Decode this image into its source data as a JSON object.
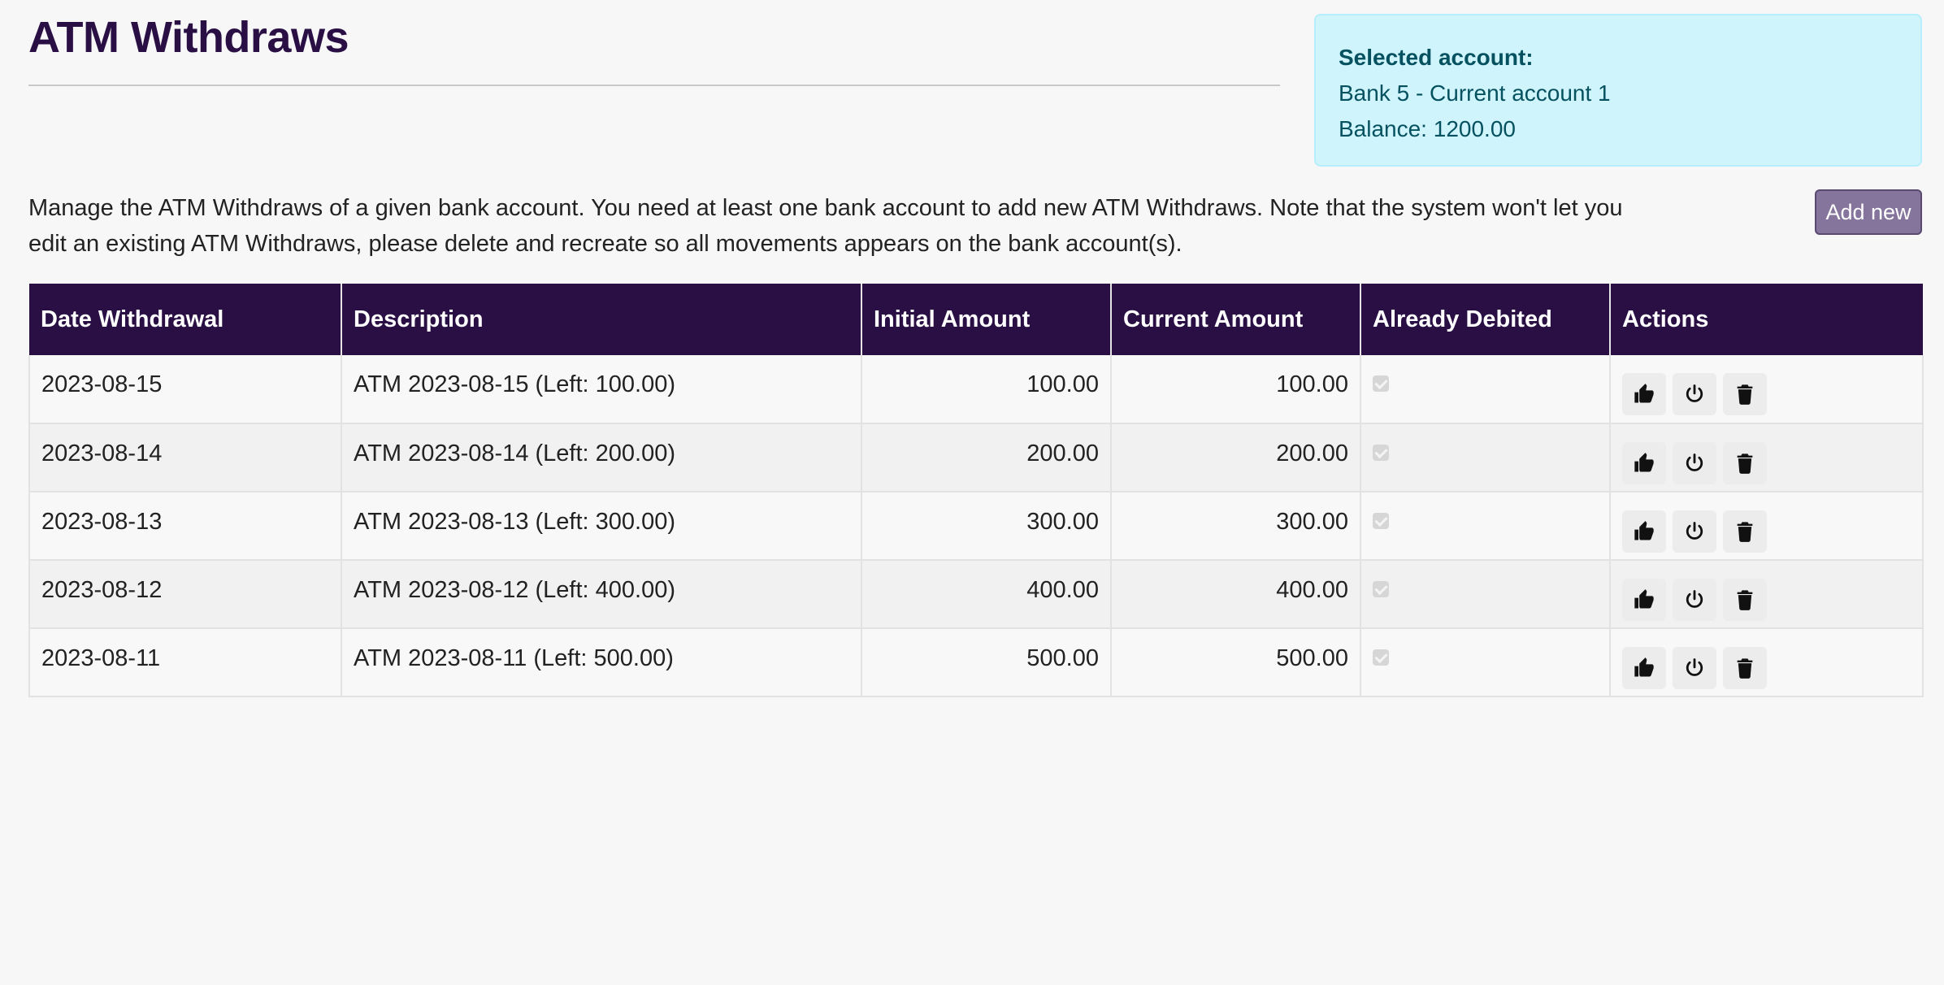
{
  "header": {
    "title": "ATM Withdraws"
  },
  "account": {
    "heading": "Selected account:",
    "name": "Bank 5 - Current account 1",
    "balance": "Balance: 1200.00"
  },
  "intro": "Manage the ATM Withdraws of a given bank account. You need at least one bank account to add new ATM Withdraws. Note that the system won't let you edit an existing ATM Withdraws, please delete and recreate so all movements appears on the bank account(s).",
  "toolbar": {
    "add_label": "Add new"
  },
  "table": {
    "columns": [
      "Date Withdrawal",
      "Description",
      "Initial Amount",
      "Current Amount",
      "Already Debited",
      "Actions"
    ],
    "rows": [
      {
        "date": "2023-08-15",
        "description": "ATM 2023-08-15 (Left: 100.00)",
        "initial": "100.00",
        "current": "100.00",
        "debited": true
      },
      {
        "date": "2023-08-14",
        "description": "ATM 2023-08-14 (Left: 200.00)",
        "initial": "200.00",
        "current": "200.00",
        "debited": true
      },
      {
        "date": "2023-08-13",
        "description": "ATM 2023-08-13 (Left: 300.00)",
        "initial": "300.00",
        "current": "300.00",
        "debited": true
      },
      {
        "date": "2023-08-12",
        "description": "ATM 2023-08-12 (Left: 400.00)",
        "initial": "400.00",
        "current": "400.00",
        "debited": true
      },
      {
        "date": "2023-08-11",
        "description": "ATM 2023-08-11 (Left: 500.00)",
        "initial": "500.00",
        "current": "500.00",
        "debited": true
      }
    ],
    "row_actions": [
      "thumbs-up-icon",
      "power-icon",
      "trash-icon"
    ]
  },
  "colors": {
    "header_bg": "#2a0f45",
    "info_bg": "#cff4fc",
    "info_text": "#055160",
    "button_bg": "#85749b"
  }
}
